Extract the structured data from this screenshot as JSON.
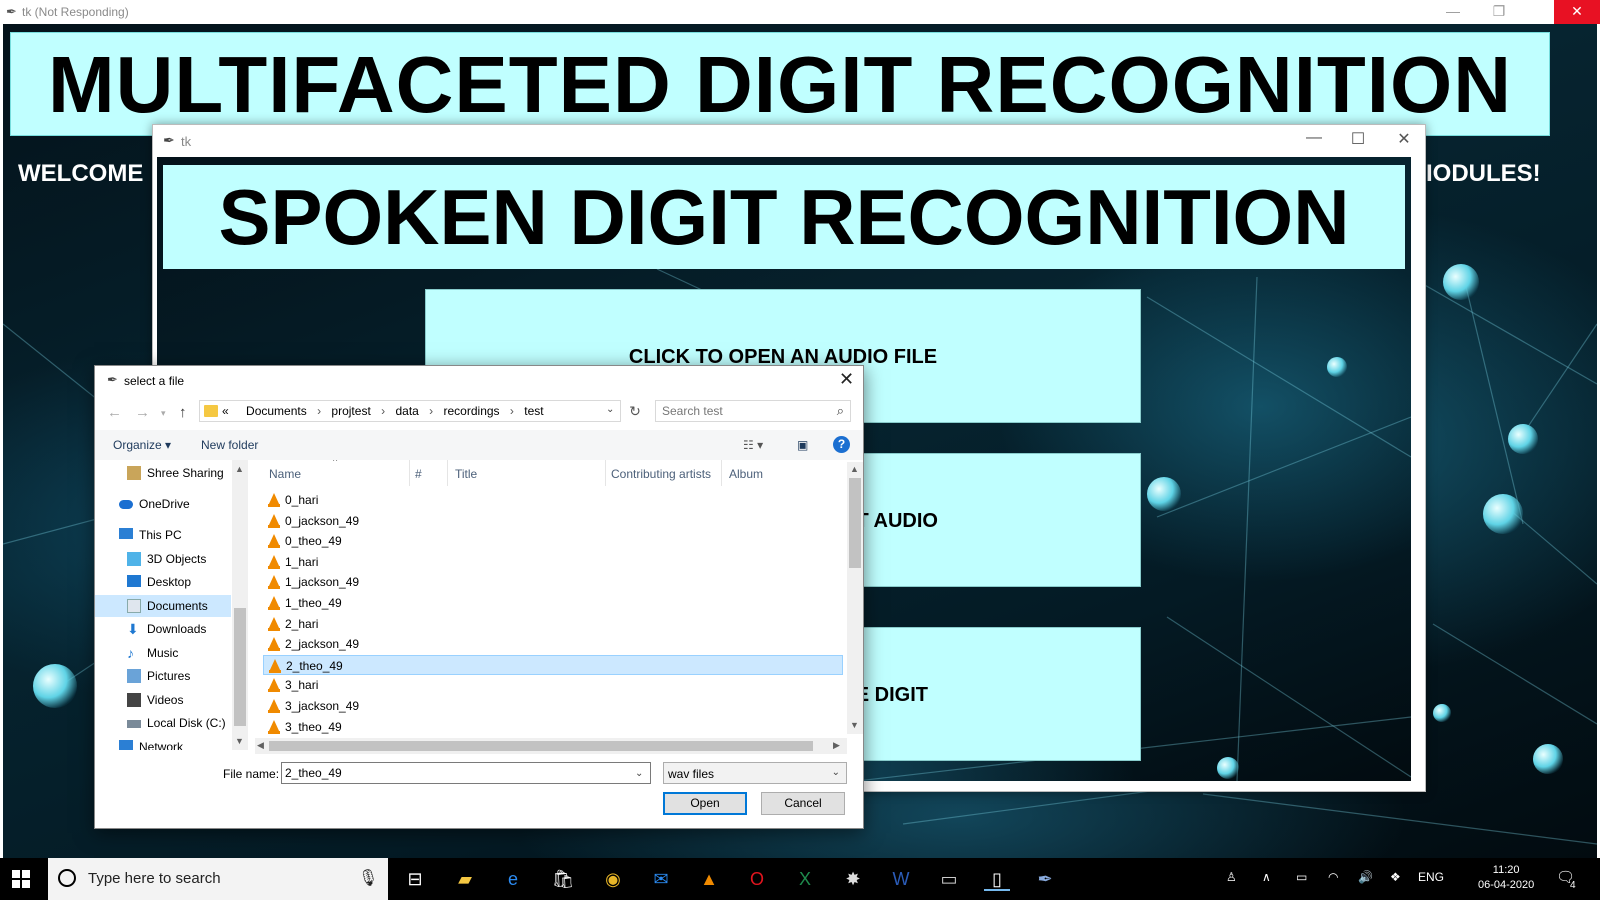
{
  "bg_window": {
    "title": "tk (Not Responding)",
    "main_title": "MULTIFACETED DIGIT RECOGNITION",
    "welcome_left": "WELCOME",
    "welcome_right": "IODULES!"
  },
  "mid_window": {
    "title": "tk",
    "heading": "SPOKEN DIGIT RECOGNITION",
    "buttons": [
      "CLICK TO OPEN AN AUDIO FILE",
      "T AUDIO",
      "E DIGIT"
    ]
  },
  "dialog": {
    "title": "select a file",
    "breadcrumb": [
      "«",
      "Documents",
      "projtest",
      "data",
      "recordings",
      "test"
    ],
    "search_placeholder": "Search test",
    "organize": "Organize ▾",
    "new_folder": "New folder",
    "help": "?",
    "tree": [
      {
        "label": "Shree Sharing",
        "icon": "shared-folder-icon"
      },
      {
        "label": "OneDrive",
        "icon": "onedrive-icon"
      },
      {
        "label": "This PC",
        "icon": "pc-icon"
      },
      {
        "label": "3D Objects",
        "icon": "3d-objects-icon"
      },
      {
        "label": "Desktop",
        "icon": "desktop-icon"
      },
      {
        "label": "Documents",
        "icon": "documents-icon"
      },
      {
        "label": "Downloads",
        "icon": "downloads-icon"
      },
      {
        "label": "Music",
        "icon": "music-icon"
      },
      {
        "label": "Pictures",
        "icon": "pictures-icon"
      },
      {
        "label": "Videos",
        "icon": "videos-icon"
      },
      {
        "label": "Local Disk (C:)",
        "icon": "local-disk-icon"
      },
      {
        "label": "Network",
        "icon": "network-icon"
      }
    ],
    "columns": [
      "Name",
      "#",
      "Title",
      "Contributing artists",
      "Album"
    ],
    "files": [
      "0_hari",
      "0_jackson_49",
      "0_theo_49",
      "1_hari",
      "1_jackson_49",
      "1_theo_49",
      "2_hari",
      "2_jackson_49",
      "2_theo_49",
      "3_hari",
      "3_jackson_49",
      "3_theo_49"
    ],
    "selected_file": "2_theo_49",
    "file_name_label": "File name:",
    "file_name_value": "2_theo_49",
    "file_type": "wav files",
    "open_label": "Open",
    "cancel_label": "Cancel"
  },
  "taskbar": {
    "search_placeholder": "Type here to search",
    "language": "ENG",
    "time": "11:20",
    "date": "06-04-2020",
    "notification_count": "4"
  }
}
